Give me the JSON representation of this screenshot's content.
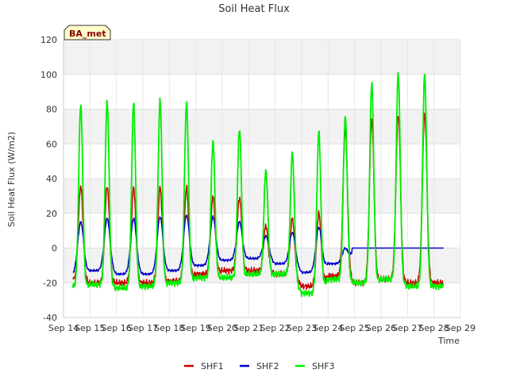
{
  "chart_data": {
    "type": "line",
    "title": "Soil Heat Flux",
    "xlabel": "Time",
    "ylabel": "Soil Heat Flux (W/m2)",
    "badge": "BA_met",
    "ylim": [
      -40,
      120
    ],
    "yticks": [
      -40,
      -20,
      0,
      20,
      40,
      60,
      80,
      100,
      120
    ],
    "xlim": [
      14,
      29
    ],
    "xtick_values": [
      14,
      15,
      16,
      17,
      18,
      19,
      20,
      21,
      22,
      23,
      24,
      25,
      26,
      27,
      28,
      29
    ],
    "xtick_labels": [
      "Sep 14",
      "Sep 15",
      "Sep 16",
      "Sep 17",
      "Sep 18",
      "Sep 19",
      "Sep 20",
      "Sep 21",
      "Sep 22",
      "Sep 23",
      "Sep 24",
      "Sep 25",
      "Sep 26",
      "Sep 27",
      "Sep 28",
      "Sep 29"
    ],
    "grid": true,
    "legend_position": "bottom-center",
    "series": [
      {
        "name": "SHF1",
        "color": "#cc0000",
        "daily_peak": [
          36,
          36,
          35,
          35,
          35,
          30,
          29,
          13,
          17,
          20,
          68,
          75,
          77,
          78
        ],
        "daily_min": [
          -18,
          -20,
          -20,
          -20,
          -19,
          -15,
          -13,
          -13,
          -15,
          -22,
          -16,
          -20,
          -18,
          -20
        ],
        "end_value": -15
      },
      {
        "name": "SHF2",
        "color": "#0000cc",
        "daily_peak": [
          15,
          17,
          17,
          18,
          19,
          18,
          15,
          7,
          9,
          12,
          0,
          0,
          0,
          0
        ],
        "daily_min": [
          -15,
          -13,
          -15,
          -15,
          -13,
          -10,
          -7,
          -6,
          -9,
          -14,
          -9,
          0,
          0,
          0
        ],
        "end_value": 0
      },
      {
        "name": "SHF3",
        "color": "#00ee00",
        "daily_peak": [
          83,
          85,
          84,
          85,
          84,
          62,
          69,
          45,
          55,
          67,
          76,
          96,
          101,
          101
        ],
        "daily_min": [
          -22,
          -21,
          -23,
          -22,
          -20,
          -17,
          -17,
          -15,
          -15,
          -26,
          -18,
          -20,
          -18,
          -22
        ],
        "end_value": -18
      }
    ]
  }
}
